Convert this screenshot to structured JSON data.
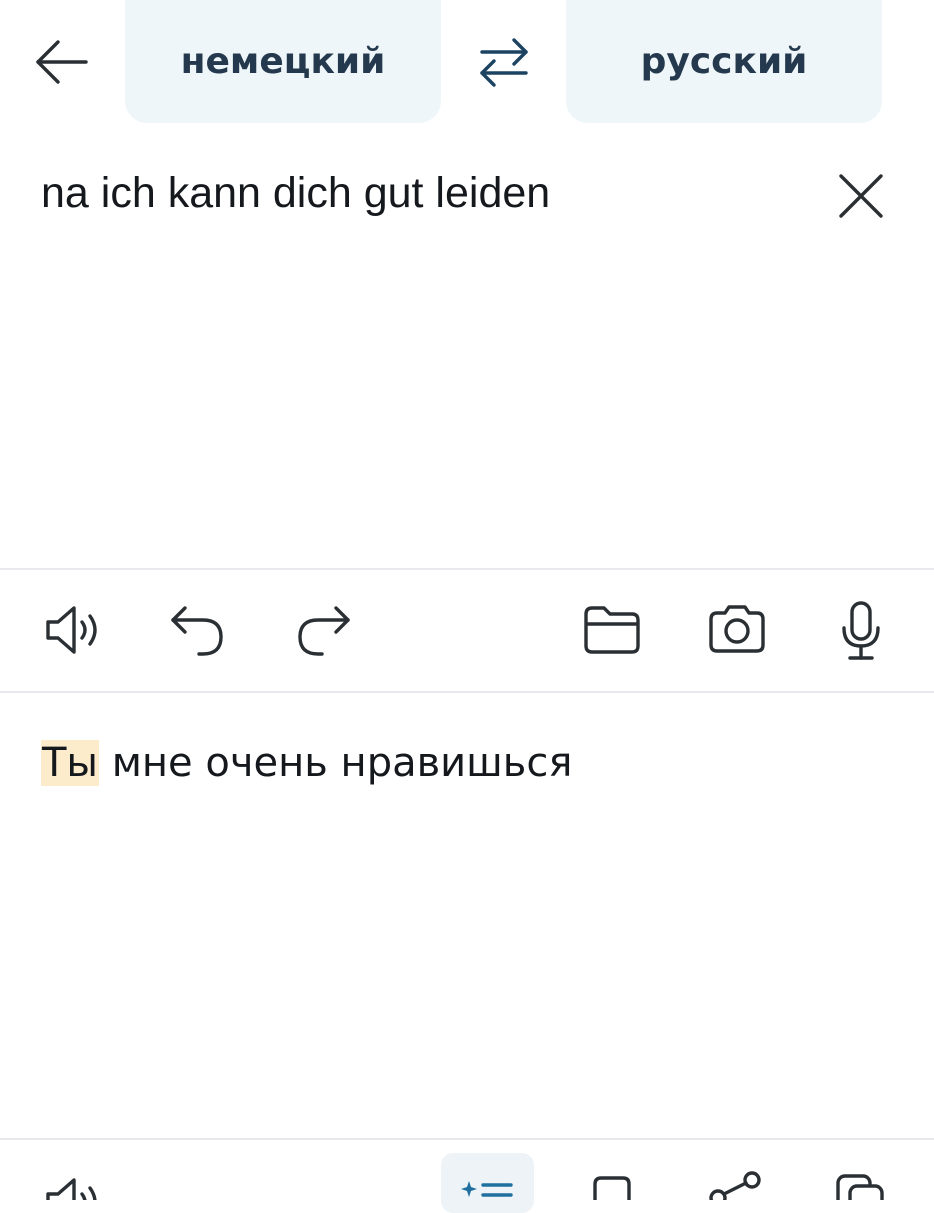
{
  "header": {
    "source_lang": "немецкий",
    "target_lang": "русский"
  },
  "input": {
    "text": "na ich kann dich gut leiden"
  },
  "output": {
    "highlighted_word": "Ты",
    "rest_text": " мне очень нравишься"
  },
  "icons": {
    "back": "arrow-left-icon",
    "swap": "swap-arrows-icon",
    "clear": "close-icon",
    "speaker": "speaker-icon",
    "undo": "undo-icon",
    "redo": "redo-icon",
    "folder": "folder-icon",
    "camera": "camera-icon",
    "mic": "microphone-icon",
    "ai": "sparkle-list-icon",
    "bookmark": "bookmark-icon",
    "share": "share-icon",
    "copy": "copy-icon"
  },
  "colors": {
    "lang_button_bg": "#eef6f9",
    "lang_button_text": "#24394d",
    "highlight": "#fdeccb",
    "accent": "#1f6f9f"
  }
}
